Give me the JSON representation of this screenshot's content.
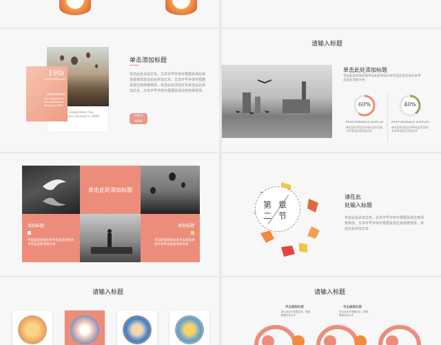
{
  "slide4": {
    "title": "请输入标题",
    "subtitle": "单击此处添加标题",
    "desc": "单击此处添加标题单击此处添加文本单击此处添加文本单击此处添加文本",
    "progress": [
      {
        "value": 0.6,
        "label": "60%",
        "caption": "PERFORMANCE DISPLAY",
        "desc": "单击此处添加文本单击此处添加文本单击此处添加文本",
        "color": "#f08a6e"
      },
      {
        "value": 0.4,
        "label": "40%",
        "caption": "PERFORMANCE DISPLAY",
        "desc": "单击此处添加文本单击此处添加文本单击此处添加文本",
        "color": "#8fa85a"
      }
    ]
  },
  "slide3": {
    "title": "单击添加标题",
    "body": "单击此处添加文本，文本字号字体可根据具体应用场景修改单击此处添加文本，文本字号字体可根据具体应用场景修改，单击此处添加文本单击此处添加文本，文本字号字体可根据具体应用场景修改。",
    "button": "CHECK MORE",
    "card_heading": "19th",
    "card_sub": "ANNIVERSARY",
    "card_info": "Information",
    "card_info_sub": "The cooperation has information formed in 1998",
    "caption_line1": "Our cooperation has",
    "caption_line2": "information formed in 1998"
  },
  "slide5": {
    "center_title": "单击此处添加标题",
    "left_title": "添加标题",
    "left_body": "单击此处添加文本单击此处添加文本单击此处添加文本",
    "right_title": "添加标题",
    "right_body": "单击此处添加文本单击此处添加文本单击此处添加文本"
  },
  "slide6": {
    "chapter_top": "第",
    "chapter_mid1": "二",
    "chapter_mid2": "章",
    "chapter_bot": "节",
    "title_line1": "请在此",
    "title_line2": "处输入标题",
    "body": "单击此处添加文本。文本字号字体可根据具体应用场景修改。文本字号字体可根据具体应用场景修改，单击此处添加文本"
  },
  "slide7": {
    "title": "请输入标题"
  },
  "slide8": {
    "title": "请输入标题",
    "label_a": "单击编辑标题",
    "label_b": "单击编辑标题",
    "desc_a": "单击此处可根据应用，根据需要添加文本",
    "desc_b": "单击此处可根据应用，根据需要添加文本"
  },
  "colors": {
    "accent": "#ec8d7b",
    "olive": "#8fa85a",
    "orange": "#f08a3e"
  }
}
